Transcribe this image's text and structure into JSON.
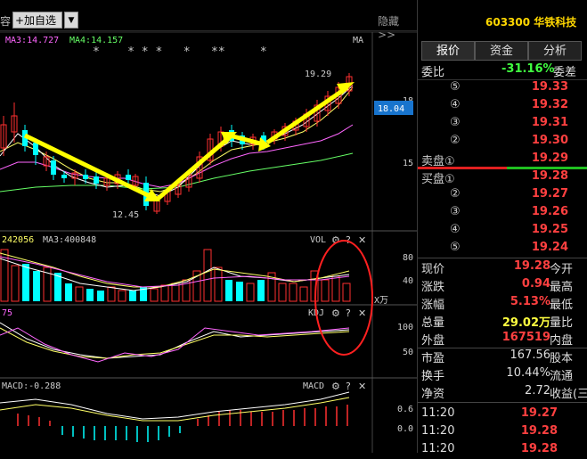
{
  "toolbar": {
    "left_label": "容",
    "add_label": "+加自选",
    "drop_glyph": "▼",
    "hide_label": "隐藏>>"
  },
  "main_chart": {
    "ma3": "MA3:14.727",
    "ma4": "MA4:14.157",
    "ma_tag": "MA",
    "high_label": "19.29",
    "low_label": "12.45",
    "axis": [
      "18",
      "18.04",
      "15"
    ],
    "stars": "*    * * *   *   **     *"
  },
  "vol_chart": {
    "val1": "242056",
    "ma3": "MA3:400848",
    "tag": "VOL",
    "axis": [
      "80",
      "40",
      "X万"
    ]
  },
  "kdj_chart": {
    "val1": "75",
    "tag": "KDJ",
    "axis": [
      "100",
      "50"
    ]
  },
  "macd_chart": {
    "val1": "MACD:-0.288",
    "tag": "MACD",
    "axis": [
      "0.6",
      "0.0"
    ]
  },
  "panel": {
    "code": "603300 华铁科技",
    "tabs": [
      "报价",
      "资金",
      "分析"
    ],
    "weibi_label": "委比",
    "weibi_value": "-31.16%",
    "weibi_tail": "委差",
    "sell": [
      {
        "n": "⑤",
        "p": "19.33"
      },
      {
        "n": "④",
        "p": "19.32"
      },
      {
        "n": "③",
        "p": "19.31"
      },
      {
        "n": "②",
        "p": "19.30"
      },
      {
        "n": "卖盘①",
        "p": "19.29"
      }
    ],
    "buy": [
      {
        "n": "买盘①",
        "p": "19.28"
      },
      {
        "n": "②",
        "p": "19.27"
      },
      {
        "n": "③",
        "p": "19.26"
      },
      {
        "n": "④",
        "p": "19.25"
      },
      {
        "n": "⑤",
        "p": "19.24"
      }
    ],
    "quotes": [
      {
        "k": "现价",
        "v": "19.28",
        "t": "今开"
      },
      {
        "k": "涨跌",
        "v": "0.94",
        "t": "最高"
      },
      {
        "k": "涨幅",
        "v": "5.13%",
        "t": "最低"
      },
      {
        "k": "总量",
        "v": "29.02万",
        "t": "量比"
      },
      {
        "k": "外盘",
        "v": "167519",
        "t": "内盘"
      },
      {
        "k": "市盈",
        "v": "167.56",
        "t": "股本"
      },
      {
        "k": "换手",
        "v": "10.44%",
        "t": "流通"
      },
      {
        "k": "净资",
        "v": "2.72",
        "t": "收益(三"
      }
    ],
    "ticks": [
      {
        "t": "11:20",
        "p": "19.27"
      },
      {
        "t": "11:20",
        "p": "19.28"
      },
      {
        "t": "11:20",
        "p": "19.28"
      }
    ]
  }
}
